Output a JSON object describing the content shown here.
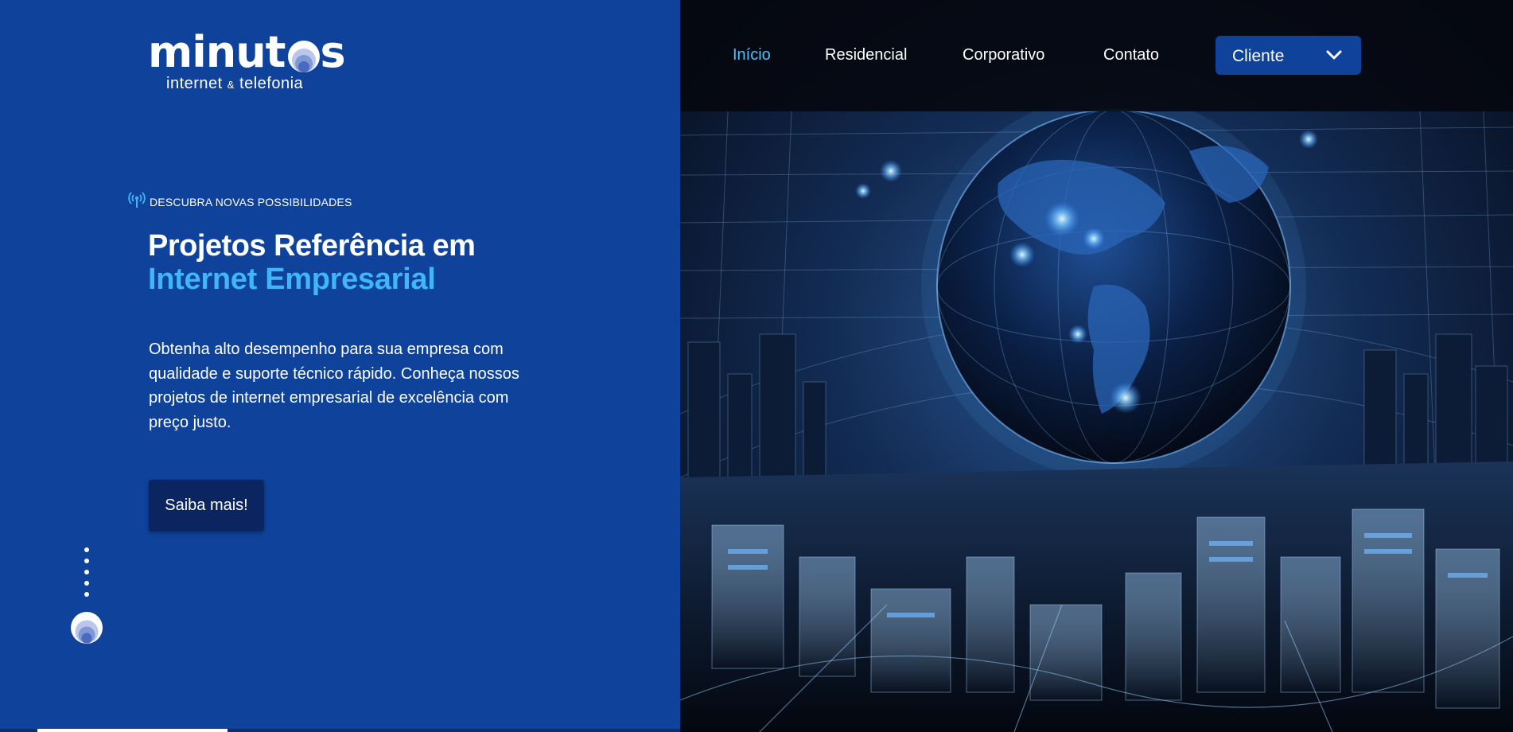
{
  "brand": {
    "logo_word": "minut",
    "logo_end": "s",
    "tagline_a": "internet",
    "tagline_amp": "&",
    "tagline_b": "telefonia"
  },
  "nav": {
    "items": [
      {
        "label": "Início",
        "active": true
      },
      {
        "label": "Residencial",
        "active": false
      },
      {
        "label": "Corporativo",
        "active": false
      },
      {
        "label": "Contato",
        "active": false
      }
    ],
    "client_select": {
      "label": "Cliente",
      "icon": "chevron-down-icon"
    }
  },
  "hero": {
    "eyebrow_icon": "broadcast-antenna-icon",
    "eyebrow": "DESCUBRA NOVAS POSSIBILIDADES",
    "headline_line1": "Projetos Referência em",
    "headline_line2": "Internet Empresarial",
    "description": "Obtenha alto desempenho para sua empresa com qualidade e suporte técnico rápido. Conheça nossos projetos de internet empresarial de excelência com preço justo.",
    "cta_label": "Saiba mais!",
    "image_subject": "digital-globe-city-image"
  },
  "scroll": {
    "dot_count": 5,
    "icon": "scroll-down-logo-icon"
  },
  "slider": {
    "progress": 0.28
  },
  "colors": {
    "panel_blue": "#0f429a",
    "accent_cyan": "#3fb6f6",
    "nav_active": "#49c2ff",
    "button_dark": "#0a2560",
    "nav_bg": "#050810"
  }
}
